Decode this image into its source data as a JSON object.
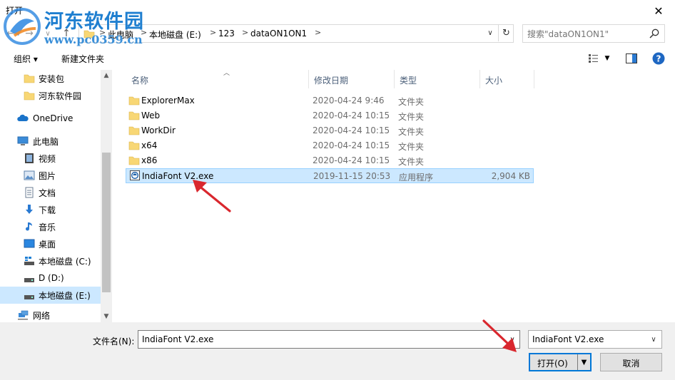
{
  "window": {
    "title": "打开",
    "close_glyph": "✕"
  },
  "watermark": {
    "name": "河东软件园",
    "url": "www.pc0359.cn"
  },
  "address": {
    "crumbs": [
      "此电脑",
      "本地磁盘 (E:)",
      "123",
      "dataON1ON1"
    ],
    "separator": ">"
  },
  "search": {
    "placeholder": "搜索\"dataON1ON1\""
  },
  "toolbar": {
    "organize": "组织 ▾",
    "new_folder": "新建文件夹"
  },
  "nav": {
    "items": [
      {
        "label": "安装包",
        "icon": "folder-icon"
      },
      {
        "label": "河东软件园",
        "icon": "folder-icon"
      },
      {
        "label": "OneDrive",
        "icon": "cloud-icon"
      },
      {
        "label": "此电脑",
        "icon": "computer-icon"
      },
      {
        "label": "视频",
        "icon": "video-icon"
      },
      {
        "label": "图片",
        "icon": "picture-icon"
      },
      {
        "label": "文档",
        "icon": "document-icon"
      },
      {
        "label": "下载",
        "icon": "download-icon"
      },
      {
        "label": "音乐",
        "icon": "music-icon"
      },
      {
        "label": "桌面",
        "icon": "desktop-icon"
      },
      {
        "label": "本地磁盘 (C:)",
        "icon": "drive-icon"
      },
      {
        "label": "D (D:)",
        "icon": "drive-icon"
      },
      {
        "label": "本地磁盘 (E:)",
        "icon": "drive-icon",
        "selected": true
      },
      {
        "label": "网络",
        "icon": "network-icon"
      }
    ]
  },
  "columns": {
    "name": "名称",
    "date": "修改日期",
    "type": "类型",
    "size": "大小"
  },
  "files": [
    {
      "name": "ExplorerMax",
      "date": "2020-04-24 9:46",
      "type": "文件夹",
      "size": "",
      "icon": "folder-icon"
    },
    {
      "name": "Web",
      "date": "2020-04-24 10:15",
      "type": "文件夹",
      "size": "",
      "icon": "folder-icon"
    },
    {
      "name": "WorkDir",
      "date": "2020-04-24 10:15",
      "type": "文件夹",
      "size": "",
      "icon": "folder-icon"
    },
    {
      "name": "x64",
      "date": "2020-04-24 10:15",
      "type": "文件夹",
      "size": "",
      "icon": "folder-icon"
    },
    {
      "name": "x86",
      "date": "2020-04-24 10:15",
      "type": "文件夹",
      "size": "",
      "icon": "folder-icon"
    },
    {
      "name": "IndiaFont V2.exe",
      "date": "2019-11-15 20:53",
      "type": "应用程序",
      "size": "2,904 KB",
      "icon": "app-icon",
      "selected": true
    }
  ],
  "bottom": {
    "filename_label": "文件名(N):",
    "filename_value": "IndiaFont V2.exe",
    "filetype_value": "IndiaFont V2.exe",
    "open_label": "打开(O)",
    "cancel_label": "取消"
  },
  "colors": {
    "accent": "#0078d7",
    "selection": "#cce8ff",
    "annotation_arrow": "#d9272e"
  }
}
